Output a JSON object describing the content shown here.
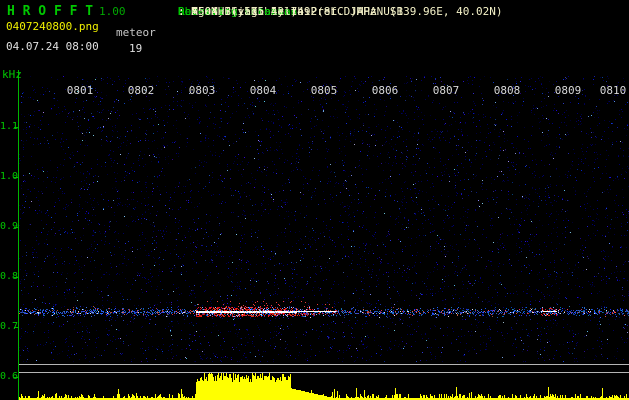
{
  "header": {
    "app_name": "H R O F F T",
    "version": "1.00",
    "filename": "0407240800.png",
    "mode_label": "meteor",
    "datetime": "04.07.24 08:00",
    "echo_count": "19",
    "info": [
      {
        "label": "Observer",
        "value": ": Masayuki Kobayashi"
      },
      {
        "label": "Receiving Location",
        "value": ": Ogata-vill. Akita-Pref. JAPAN (139.96E, 40.02N)"
      },
      {
        "label": "Receiver",
        "value": ": ICOM IC-575 53.7492(8LCD)MHz USB"
      },
      {
        "label": "Receiving antenna",
        "value": ": A504HB(yagi 4el)"
      }
    ]
  },
  "chart_data": {
    "type": "heatmap",
    "subtype": "radio-meteor-spectrogram",
    "time_start": "08:00",
    "time_end": "08:10",
    "x_ticks": [
      "0801",
      "0802",
      "0803",
      "0804",
      "0805",
      "0806",
      "0807",
      "0808",
      "0809",
      "0810"
    ],
    "y_label": "kHz",
    "y_ticks": [
      "1.1",
      "1.0",
      "0.9",
      "0.8",
      "0.7",
      "0.6"
    ],
    "y_range_khz": [
      0.6,
      1.1
    ],
    "noise_color": "#2233cc",
    "events": [
      {
        "id": "carrier-trace",
        "start_min": 0.05,
        "end_min": 9.9,
        "freq_khz": 0.73,
        "strength": "faint"
      },
      {
        "id": "meteor-echo-main",
        "start_min": 2.9,
        "end_min": 5.2,
        "freq_khz": 0.73,
        "strength": "strong"
      },
      {
        "id": "meteor-echo-minor",
        "start_min": 8.55,
        "end_min": 8.8,
        "freq_khz": 0.73,
        "strength": "weak"
      }
    ],
    "level_meter": {
      "bar_color": "#ffff00",
      "burst_start_min": 2.9,
      "burst_end_min": 4.45
    }
  },
  "colors": {
    "title_green": "#00c800",
    "label_green": "#00c800",
    "filename_yellow": "#f0f000",
    "value_cream": "#f5f2c8",
    "axis_green": "#00b400",
    "separator_gray": "#b4b4b4",
    "time_label_white": "#d8d8d8"
  }
}
